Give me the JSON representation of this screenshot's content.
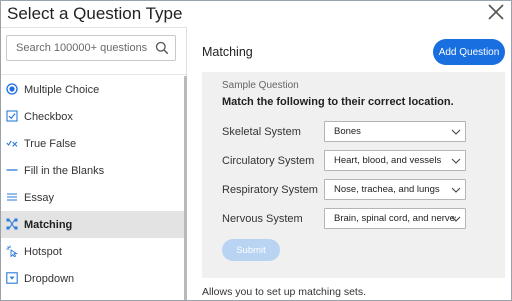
{
  "dialog": {
    "title": "Select a Question Type",
    "close_icon": "close-icon"
  },
  "sidebar": {
    "search": {
      "placeholder": "Search 100000+ questions",
      "value": "",
      "icon": "search-icon"
    },
    "items": [
      {
        "label": "Multiple Choice",
        "icon": "radio-icon",
        "active": false
      },
      {
        "label": "Checkbox",
        "icon": "checkbox-icon",
        "active": false
      },
      {
        "label": "True False",
        "icon": "check-cross-icon",
        "active": false
      },
      {
        "label": "Fill in the Blanks",
        "icon": "blank-line-icon",
        "active": false
      },
      {
        "label": "Essay",
        "icon": "text-lines-icon",
        "active": false
      },
      {
        "label": "Matching",
        "icon": "matching-icon",
        "active": true
      },
      {
        "label": "Hotspot",
        "icon": "hotspot-icon",
        "active": false
      },
      {
        "label": "Dropdown",
        "icon": "dropdown-icon",
        "active": false
      }
    ]
  },
  "main": {
    "heading": "Matching",
    "add_button": "Add Question",
    "preview": {
      "label": "Sample Question",
      "question": "Match the following to their correct location.",
      "rows": [
        {
          "label": "Skeletal System",
          "selected": "Bones"
        },
        {
          "label": "Circulatory System",
          "selected": "Heart, blood, and vessels"
        },
        {
          "label": "Respiratory System",
          "selected": "Nose, trachea, and lungs"
        },
        {
          "label": "Nervous System",
          "selected": "Brain, spinal cord, and nerves"
        }
      ],
      "submit": "Submit"
    },
    "description": "Allows you to set up matching sets."
  },
  "colors": {
    "accent": "#1a6fe0",
    "submit_disabled": "#b9d3f2",
    "active_item_bg": "#e3e3e3",
    "preview_bg": "#f0f0f0"
  }
}
